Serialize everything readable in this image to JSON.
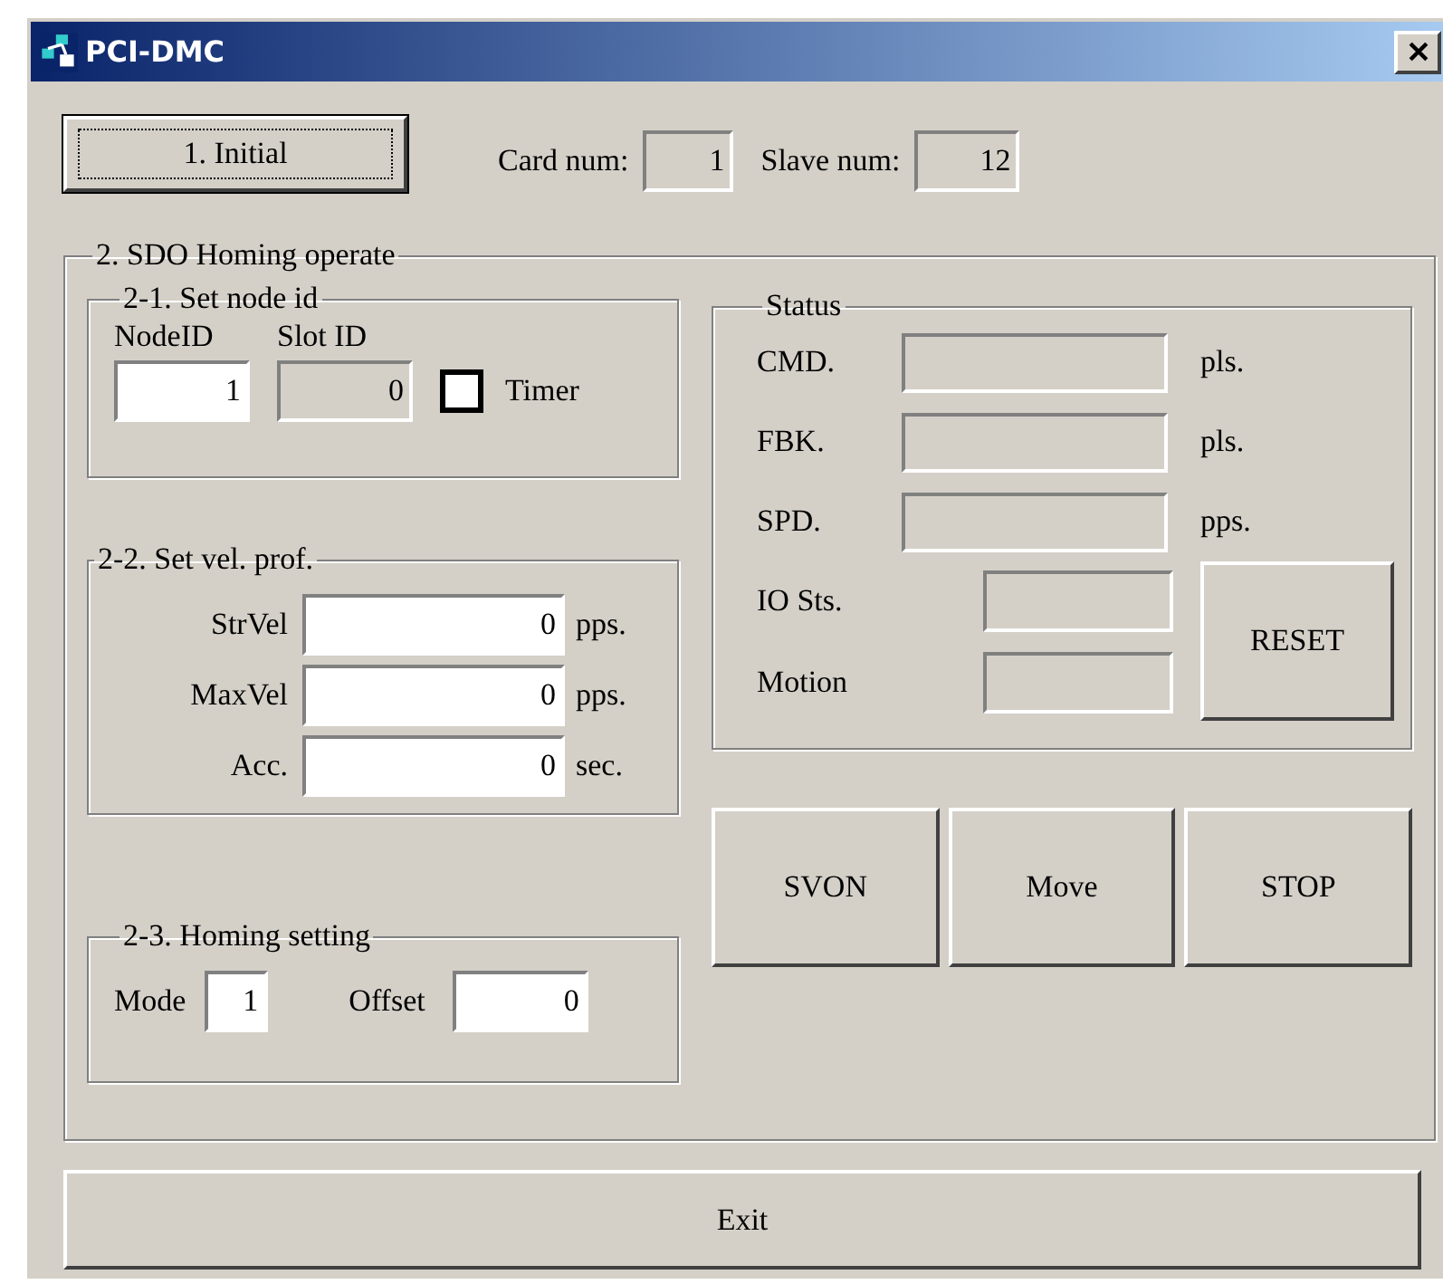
{
  "window": {
    "title": "PCI-DMC"
  },
  "initial_button": "1. Initial",
  "card_num": {
    "label": "Card num:",
    "value": "1",
    "readonly": true
  },
  "slave_num": {
    "label": "Slave num:",
    "value": "12",
    "readonly": true
  },
  "sdo_group": {
    "title": "2. SDO Homing operate",
    "node_group": {
      "title": "2-1. Set node id",
      "node_id": {
        "label": "NodeID",
        "value": "1",
        "readonly": false
      },
      "slot_id": {
        "label": "Slot ID",
        "value": "0",
        "readonly": true
      },
      "timer": {
        "label": "Timer",
        "checked": false
      }
    },
    "vel_group": {
      "title": "2-2. Set vel. prof.",
      "rows": [
        {
          "label": "StrVel",
          "value": "0",
          "unit": "pps.",
          "readonly": false
        },
        {
          "label": "MaxVel",
          "value": "0",
          "unit": "pps.",
          "readonly": false
        },
        {
          "label": "Acc.",
          "value": "0",
          "unit": "sec.",
          "readonly": false
        }
      ]
    },
    "homing_group": {
      "title": "2-3. Homing setting",
      "mode": {
        "label": "Mode",
        "value": "1",
        "readonly": false
      },
      "offset": {
        "label": "Offset",
        "value": "0",
        "readonly": false
      }
    },
    "status": {
      "title": "Status",
      "readouts": [
        {
          "label": "CMD.",
          "unit": "pls."
        },
        {
          "label": "FBK.",
          "unit": "pls."
        },
        {
          "label": "SPD.",
          "unit": "pps."
        }
      ],
      "indicators": [
        {
          "label": "IO Sts."
        },
        {
          "label": "Motion"
        }
      ],
      "reset_button": "RESET"
    },
    "buttons": [
      "SVON",
      "Move",
      "STOP"
    ]
  },
  "exit_button": "Exit"
}
